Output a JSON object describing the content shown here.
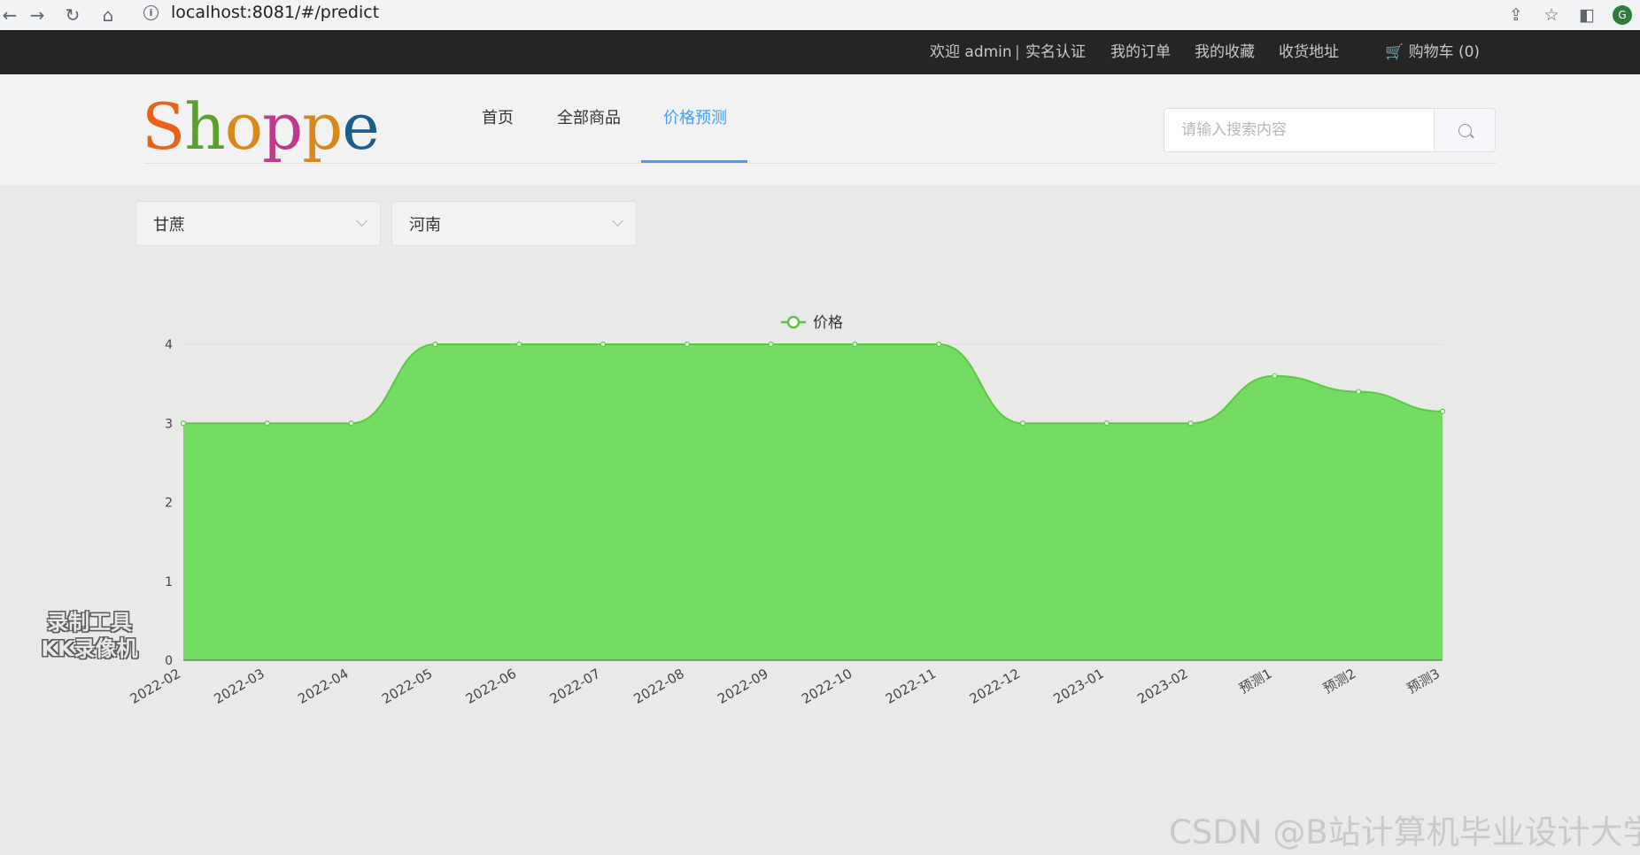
{
  "browser": {
    "url": "localhost:8081/#/predict",
    "info_icon": "info-icon",
    "avatar_letter": "G"
  },
  "topbar": {
    "welcome": "欢迎 admin",
    "separator": "|",
    "verify": "实名认证",
    "orders": "我的订单",
    "favorites": "我的收藏",
    "address": "收货地址",
    "cart": "🛒 购物车 (0)"
  },
  "header": {
    "logo": [
      "S",
      "h",
      "o",
      "p",
      "p",
      "e"
    ],
    "logo_colors": [
      "#e8621a",
      "#5aa02c",
      "#d8891c",
      "#c0398a",
      "#d8891c",
      "#1a5e8e"
    ],
    "nav": {
      "home": "首页",
      "all": "全部商品",
      "predict": "价格预测"
    },
    "search_placeholder": "请输入搜索内容",
    "accent": "#409eff"
  },
  "filters": {
    "product": "甘蔗",
    "region": "河南"
  },
  "watermarks": {
    "left_line1": "录制工具",
    "left_line2": "KK录像机",
    "right": "CSDN @B站计算机毕业设计大学"
  },
  "chart_data": {
    "type": "area",
    "legend": [
      "价格"
    ],
    "legend_position": "top-center",
    "categories": [
      "2022-02",
      "2022-03",
      "2022-04",
      "2022-05",
      "2022-06",
      "2022-07",
      "2022-08",
      "2022-09",
      "2022-10",
      "2022-11",
      "2022-12",
      "2023-01",
      "2023-02",
      "预测1",
      "预测2",
      "预测3"
    ],
    "series": [
      {
        "name": "价格",
        "values": [
          3,
          3,
          3,
          4,
          4,
          4,
          4,
          4,
          4,
          4,
          3,
          3,
          3,
          3.6,
          3.4,
          3.15
        ]
      }
    ],
    "ylim": [
      0,
      4
    ],
    "yticks": [
      0,
      1,
      2,
      3,
      4
    ],
    "smooth": true,
    "grid": true,
    "line_color": "#5ac941",
    "fill_color": "#74dc64"
  }
}
